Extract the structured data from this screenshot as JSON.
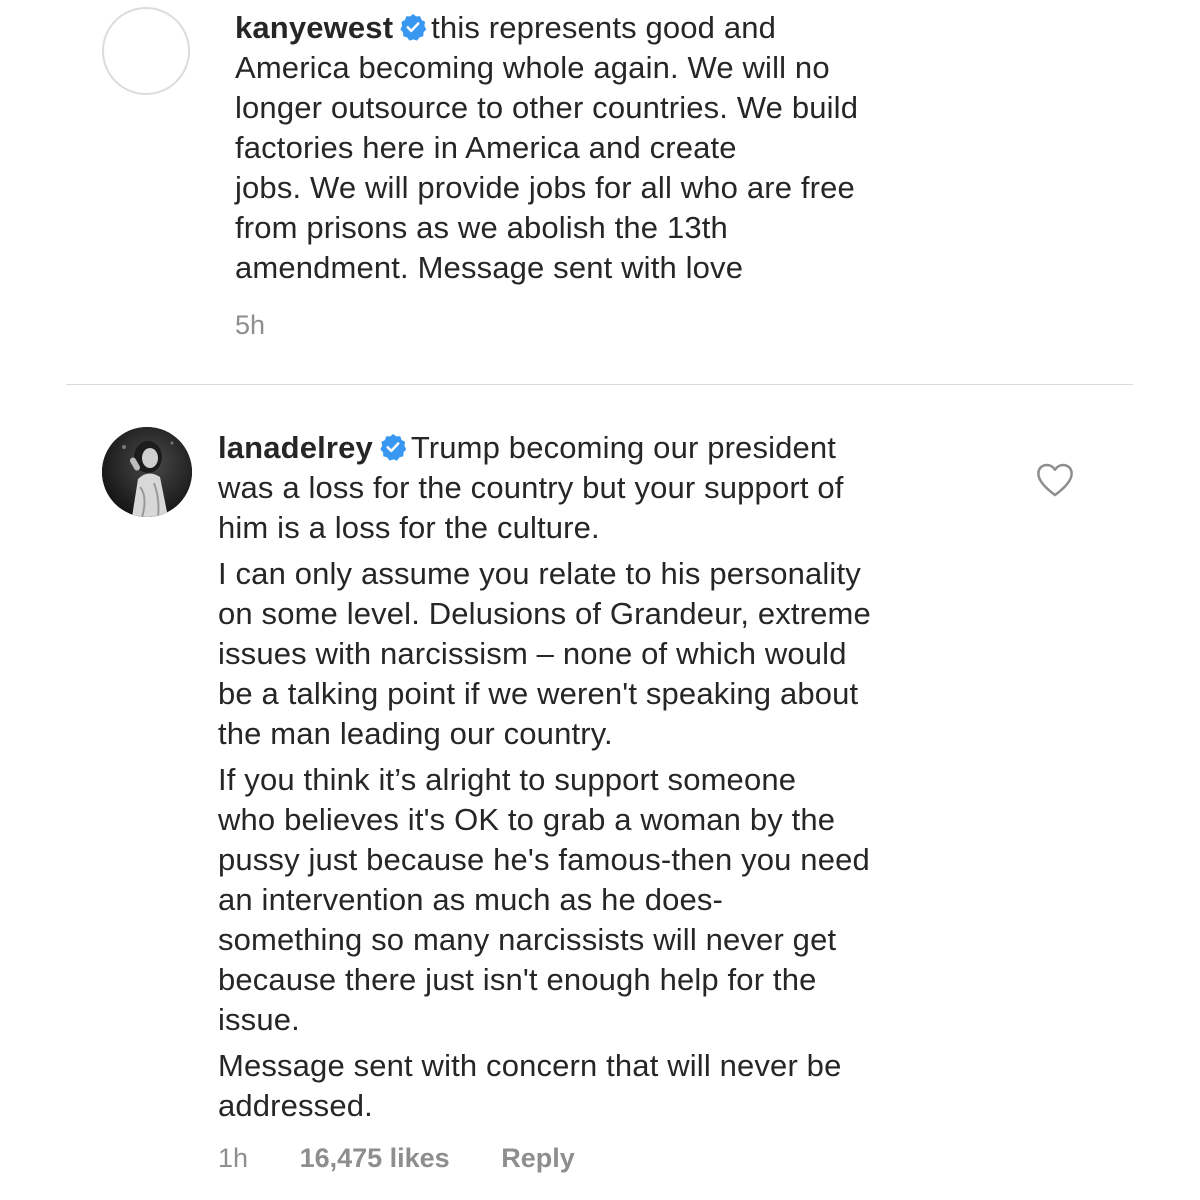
{
  "comments": [
    {
      "username": "kanyewest",
      "verified": true,
      "lines": [
        "this represents good and",
        "America becoming whole again.  We will no",
        "longer outsource to other countries. We build",
        "factories here in America and create",
        "jobs.  We will provide jobs for all who are free",
        "from prisons as we abolish the 13th",
        "amendment. Message sent with love"
      ],
      "time": "5h"
    },
    {
      "username": "lanadelrey",
      "verified": true,
      "paragraphs": [
        [
          "Trump becoming our president",
          "was a loss for the country but your support of",
          "him is a loss for the culture."
        ],
        [
          "I can only assume you relate to his personality",
          "on some level. Delusions of Grandeur, extreme",
          "issues with narcissism – none of which would",
          "be a talking point if we weren't speaking about",
          "the man leading our country."
        ],
        [
          "If you think it’s alright to support someone",
          "who believes it's OK to grab a woman by the",
          "pussy just because he's famous-then you need",
          "an intervention as much as he does-",
          "something so many narcissists will never get",
          "because there just isn't enough help for the",
          "issue."
        ],
        [
          "Message sent with concern that will never be",
          "addressed."
        ]
      ],
      "time": "1h",
      "likes": "16,475 likes",
      "reply_label": "Reply"
    }
  ],
  "icons": {
    "verified": "verified-badge-icon",
    "like": "heart-outline-icon"
  },
  "colors": {
    "verified_blue": "#3897f0",
    "meta_gray": "#8e8e8e",
    "text": "#262626"
  }
}
